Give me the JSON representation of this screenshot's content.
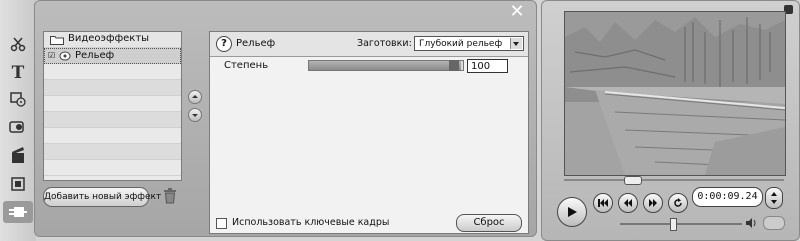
{
  "effects": {
    "category_label": "Видеоэффекты",
    "selected_effect": "Рельеф",
    "add_button_label": "Добавить новый эффект"
  },
  "settings": {
    "effect_name": "Рельеф",
    "presets_label": "Заготовки:",
    "preset_value": "Глубокий рельеф",
    "param_label": "Степень",
    "param_value": "100",
    "param_fraction": 0.99,
    "keyframes_label": "Использовать ключевые кадры",
    "reset_label": "Сброс"
  },
  "player": {
    "timecode": "0:00:09.24"
  },
  "icons": {
    "toolbar": [
      "effects-scissors-icon",
      "title-text-icon",
      "menu-disc-icon",
      "sound-icon",
      "clapper-icon",
      "transition-icon",
      "plug-icon"
    ],
    "transport": [
      "play-icon",
      "skip-start-icon",
      "rewind-icon",
      "fast-forward-icon",
      "loop-icon"
    ]
  }
}
